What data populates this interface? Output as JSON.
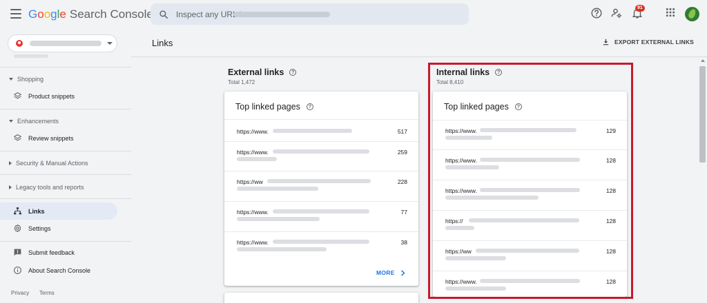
{
  "header": {
    "brand": {
      "letters": [
        "G",
        "o",
        "o",
        "g",
        "l",
        "e"
      ],
      "product": "Search Console"
    },
    "search_placeholder": "Inspect any URL in",
    "notification_count": "91",
    "icons": [
      "menu-icon",
      "search-icon",
      "help-icon",
      "manage-users-icon",
      "bell-icon",
      "apps-grid-icon",
      "account-avatar"
    ]
  },
  "sidebar": {
    "sections": {
      "shopping": "Shopping",
      "enhancements": "Enhancements",
      "security": "Security & Manual Actions",
      "legacy": "Legacy tools and reports"
    },
    "items": {
      "product_snippets": "Product snippets",
      "review_snippets": "Review snippets",
      "links": "Links",
      "settings": "Settings",
      "submit_feedback": "Submit feedback",
      "about": "About Search Console"
    },
    "footer": {
      "privacy": "Privacy",
      "terms": "Terms"
    }
  },
  "main": {
    "title": "Links",
    "export_label": "EXPORT EXTERNAL LINKS",
    "external": {
      "title": "External links",
      "total": "Total 1,472",
      "card_title": "Top linked pages",
      "rows": [
        {
          "url": "https://www.",
          "value": "517"
        },
        {
          "url": "https://www.",
          "value": "259"
        },
        {
          "url": "https://ww",
          "value": "228"
        },
        {
          "url": "https://www.",
          "value": "77"
        },
        {
          "url": "https://www.",
          "value": "38"
        }
      ],
      "more_label": "MORE"
    },
    "internal": {
      "title": "Internal links",
      "total": "Total 8,410",
      "card_title": "Top linked pages",
      "rows": [
        {
          "url": "https://www.",
          "value": "129"
        },
        {
          "url": "https://www.",
          "value": "128"
        },
        {
          "url": "https://www.",
          "value": "128"
        },
        {
          "url": "https://",
          "value": "128"
        },
        {
          "url": "https://ww",
          "value": "128"
        },
        {
          "url": "https://www.",
          "value": "128"
        }
      ]
    }
  },
  "colors": {
    "accent_blue": "#1a73e8",
    "highlight_red": "#c7192d",
    "active_nav_bg": "#e3eaf6",
    "page_bg": "#f1f3f4"
  }
}
